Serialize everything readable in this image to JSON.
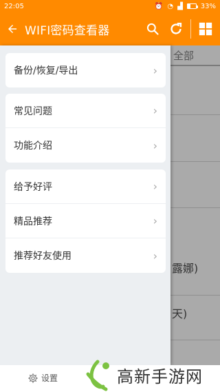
{
  "statusbar": {
    "time": "22:05",
    "battery": "33%"
  },
  "appbar": {
    "title": "WIFI密码查看器"
  },
  "drawer": {
    "groups": [
      {
        "items": [
          {
            "label": "备份/恢复/导出"
          }
        ]
      },
      {
        "items": [
          {
            "label": "常见问题"
          },
          {
            "label": "功能介绍"
          }
        ]
      },
      {
        "items": [
          {
            "label": "给予好评"
          },
          {
            "label": "精品推荐"
          },
          {
            "label": "推荐好友使用"
          }
        ]
      }
    ]
  },
  "background": {
    "tab_label": "全部",
    "partial_texts": [
      "露娜)",
      "天)"
    ]
  },
  "settings": {
    "label": "设置"
  },
  "watermark": {
    "text": "高新手游网"
  },
  "colors": {
    "accent": "#ff8a00",
    "drawer_bg": "#eceff2"
  },
  "icons": [
    "back-arrow-icon",
    "search-icon",
    "refresh-icon",
    "grid-icon",
    "chevron-right-icon",
    "gear-icon"
  ]
}
